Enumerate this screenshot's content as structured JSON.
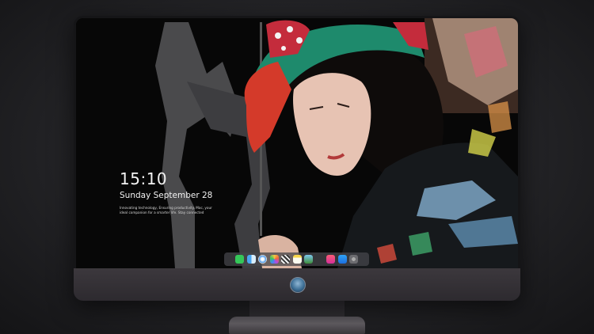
{
  "lock_screen": {
    "time": "15:10",
    "date": "Sunday September 28",
    "tagline": "Innovating technology, Ensuring productivity. Mac, your ideal companion for a smarter life. Stay connected"
  },
  "dock": {
    "apps": [
      "messages-icon",
      "finder-icon",
      "safari-icon",
      "photos-icon",
      "claquette-icon",
      "notes-icon",
      "preview-icon",
      "music-icon",
      "appstore-icon",
      "system-settings-icon"
    ]
  },
  "colors": {
    "chin": "#3c383d",
    "stand": "#5c585d",
    "dock": "#46464b"
  }
}
